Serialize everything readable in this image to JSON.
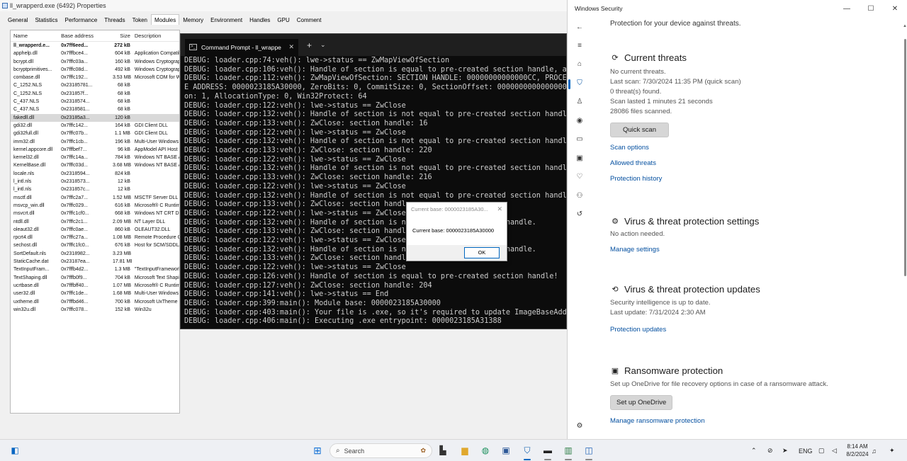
{
  "props_window": {
    "title": "ll_wrapperd.exe (6492) Properties",
    "tabs": [
      "General",
      "Statistics",
      "Performance",
      "Threads",
      "Token",
      "Modules",
      "Memory",
      "Environment",
      "Handles",
      "GPU",
      "Comment"
    ],
    "active_tab": "Modules",
    "columns": [
      "Name",
      "Base address",
      "Size",
      "Description"
    ],
    "rows": [
      {
        "name": "ll_wrapperd.e...",
        "base": "0x7ff6eed...",
        "size": "272 kB",
        "desc": "",
        "bold": true
      },
      {
        "name": "apphelp.dll",
        "base": "0x7fffbce4...",
        "size": "604 kB",
        "desc": "Application Compatibilit"
      },
      {
        "name": "bcrypt.dll",
        "base": "0x7fffc03a...",
        "size": "160 kB",
        "desc": "Windows Cryptographi"
      },
      {
        "name": "bcryptprimitives...",
        "base": "0x7fffc08d...",
        "size": "492 kB",
        "desc": "Windows Cryptographi"
      },
      {
        "name": "combase.dll",
        "base": "0x7fffc192...",
        "size": "3.53 MB",
        "desc": "Microsoft COM for Wind"
      },
      {
        "name": "C_1252.NLS",
        "base": "0x23185781...",
        "size": "68 kB",
        "desc": ""
      },
      {
        "name": "C_1252.NLS",
        "base": "0x231857f...",
        "size": "68 kB",
        "desc": ""
      },
      {
        "name": "C_437.NLS",
        "base": "0x2318574...",
        "size": "68 kB",
        "desc": ""
      },
      {
        "name": "C_437.NLS",
        "base": "0x2318581...",
        "size": "68 kB",
        "desc": ""
      },
      {
        "name": "fakedll.dll",
        "base": "0x23185a3...",
        "size": "120 kB",
        "desc": "",
        "selected": true
      },
      {
        "name": "gdi32.dll",
        "base": "0x7fffc142...",
        "size": "164 kB",
        "desc": "GDI Client DLL"
      },
      {
        "name": "gdi32full.dll",
        "base": "0x7fffc07b...",
        "size": "1.1 MB",
        "desc": "GDI Client DLL"
      },
      {
        "name": "imm32.dll",
        "base": "0x7fffc1cb...",
        "size": "196 kB",
        "desc": "Multi-User Windows IM"
      },
      {
        "name": "kernel.appcore.dll",
        "base": "0x7fffbef7...",
        "size": "96 kB",
        "desc": "AppModel API Host"
      },
      {
        "name": "kernel32.dll",
        "base": "0x7fffc14a...",
        "size": "784 kB",
        "desc": "Windows NT BASE API"
      },
      {
        "name": "KernelBase.dll",
        "base": "0x7fffc03d...",
        "size": "3.68 MB",
        "desc": "Windows NT BASE API"
      },
      {
        "name": "locale.nls",
        "base": "0x2318594...",
        "size": "824 kB",
        "desc": ""
      },
      {
        "name": "l_intl.nls",
        "base": "0x2318573...",
        "size": "12 kB",
        "desc": ""
      },
      {
        "name": "l_intl.nls",
        "base": "0x231857c...",
        "size": "12 kB",
        "desc": ""
      },
      {
        "name": "msctf.dll",
        "base": "0x7fffc2a7...",
        "size": "1.52 MB",
        "desc": "MSCTF Server DLL"
      },
      {
        "name": "msvcp_win.dll",
        "base": "0x7fffc029...",
        "size": "616 kB",
        "desc": "Microsoft® C Runtime"
      },
      {
        "name": "msvcrt.dll",
        "base": "0x7fffc1cf0...",
        "size": "668 kB",
        "desc": "Windows NT CRT DLL"
      },
      {
        "name": "ntdll.dll",
        "base": "0x7fffc2c1...",
        "size": "2.09 MB",
        "desc": "NT Layer DLL"
      },
      {
        "name": "oleaut32.dll",
        "base": "0x7fffc0ae...",
        "size": "860 kB",
        "desc": "OLEAUT32.DLL"
      },
      {
        "name": "rpcrt4.dll",
        "base": "0x7fffc27a...",
        "size": "1.08 MB",
        "desc": "Remote Procedure Call"
      },
      {
        "name": "sechost.dll",
        "base": "0x7fffc1fc0...",
        "size": "676 kB",
        "desc": "Host for SCM/SDDL/LSA"
      },
      {
        "name": "SortDefault.nls",
        "base": "0x2318982...",
        "size": "3.23 MB",
        "desc": ""
      },
      {
        "name": "StaticCache.dat",
        "base": "0x23187ea...",
        "size": "17.81 MB",
        "desc": ""
      },
      {
        "name": "TextInputFram...",
        "base": "0x7fffb4d2...",
        "size": "1.3 MB",
        "desc": "\"TextInputFramework.D"
      },
      {
        "name": "TextShaping.dll",
        "base": "0x7fffb0f9...",
        "size": "704 kB",
        "desc": "Microsoft Text Shaping"
      },
      {
        "name": "ucrtbase.dll",
        "base": "0x7fffbff40...",
        "size": "1.07 MB",
        "desc": "Microsoft® C Runtime"
      },
      {
        "name": "user32.dll",
        "base": "0x7fffc1de...",
        "size": "1.68 MB",
        "desc": "Multi-User Windows US"
      },
      {
        "name": "uxtheme.dll",
        "base": "0x7fffbd46...",
        "size": "700 kB",
        "desc": "Microsoft UxTheme Lib"
      },
      {
        "name": "win32u.dll",
        "base": "0x7fffc078...",
        "size": "152 kB",
        "desc": "Win32u"
      }
    ]
  },
  "cmd_window": {
    "tab_title": "Command Prompt - ll_wrappe",
    "tab_icon": "cmd-icon",
    "new_tab": "+",
    "dropdown": "⌄",
    "lines": [
      "DEBUG: loader.cpp:74:veh(): lwe->status == ZwMapViewOfSection",
      "DEBUG: loader.cpp:106:veh(): Handle of section is equal to pre-created section handle, and",
      "DEBUG: loader.cpp:112:veh(): ZwMapViewOfSection: SECTION HANDLE: 00000000000000CC, PROCESS",
      "E ADDRESS: 0000023185A30000, ZeroBits: 0, CommitSize: 0, SectionOffset: 0000000000000000,",
      "on: 1, AllocationType: 0, Win32Protect: 64",
      "DEBUG: loader.cpp:122:veh(): lwe->status == ZwClose",
      "DEBUG: loader.cpp:132:veh(): Handle of section is not equal to pre-created section handle.",
      "DEBUG: loader.cpp:133:veh(): ZwClose: section handle: 16",
      "DEBUG: loader.cpp:122:veh(): lwe->status == ZwClose",
      "DEBUG: loader.cpp:132:veh(): Handle of section is not equal to pre-created section handle.",
      "DEBUG: loader.cpp:133:veh(): ZwClose: section handle: 220",
      "DEBUG: loader.cpp:122:veh(): lwe->status == ZwClose",
      "DEBUG: loader.cpp:132:veh(): Handle of section is not equal to pre-created section handle.",
      "DEBUG: loader.cpp:133:veh(): ZwClose: section handle: 216",
      "DEBUG: loader.cpp:122:veh(): lwe->status == ZwClose",
      "DEBUG: loader.cpp:132:veh(): Handle of section is not equal to pre-created section handle.",
      "DEBUG: loader.cpp:133:veh(): ZwClose: section handle",
      "DEBUG: loader.cpp:122:veh(): lwe->status == ZwClose",
      "DEBUG: loader.cpp:132:veh(): Handle of section is not              ection handle.",
      "DEBUG: loader.cpp:133:veh(): ZwClose: section handle",
      "DEBUG: loader.cpp:122:veh(): lwe->status == ZwClose",
      "DEBUG: loader.cpp:132:veh(): Handle of section is not              ection handle.",
      "DEBUG: loader.cpp:133:veh(): ZwClose: section handle",
      "DEBUG: loader.cpp:122:veh(): lwe->status == ZwClose",
      "DEBUG: loader.cpp:126:veh(): Handle of section is equal to pre-created section handle!",
      "DEBUG: loader.cpp:127:veh(): ZwClose: section handle: 204",
      "DEBUG: loader.cpp:141:veh(): lwe->status == End",
      "DEBUG: loader.cpp:399:main(): Module base: 0000023185A30000",
      "DEBUG: loader.cpp:403:main(): Your file is .exe, so it's required to update ImageBaseAddre",
      "DEBUG: loader.cpp:406:main(): Executing .exe entrypoint: 0000023185A31388"
    ]
  },
  "message_box": {
    "title": "Current base: 0000023185A30...",
    "text": "Current base: 0000023185A30000",
    "ok_label": "OK"
  },
  "security": {
    "window_title": "Windows Security",
    "intro": "Protection for your device against threats.",
    "current_threats": {
      "title": "Current threats",
      "lines": [
        "No current threats.",
        "Last scan: 7/30/2024 11:35 PM (quick scan)",
        "0 threat(s) found.",
        "Scan lasted 1 minutes 21 seconds",
        "28086 files scanned."
      ],
      "button": "Quick scan",
      "links": [
        "Scan options",
        "Allowed threats",
        "Protection history"
      ]
    },
    "settings": {
      "title": "Virus & threat protection settings",
      "line": "No action needed.",
      "link": "Manage settings"
    },
    "updates": {
      "title": "Virus & threat protection updates",
      "lines": [
        "Security intelligence is up to date.",
        "Last update: 7/31/2024 2:30 AM"
      ],
      "link": "Protection updates"
    },
    "ransomware": {
      "title": "Ransomware protection",
      "line": "Set up OneDrive for file recovery options in case of a ransomware attack.",
      "button": "Set up OneDrive",
      "link": "Manage ransomware protection"
    }
  },
  "taskbar": {
    "search_placeholder": "Search",
    "language": "ENG",
    "time": "8:14 AM",
    "date": "8/2/2024"
  }
}
